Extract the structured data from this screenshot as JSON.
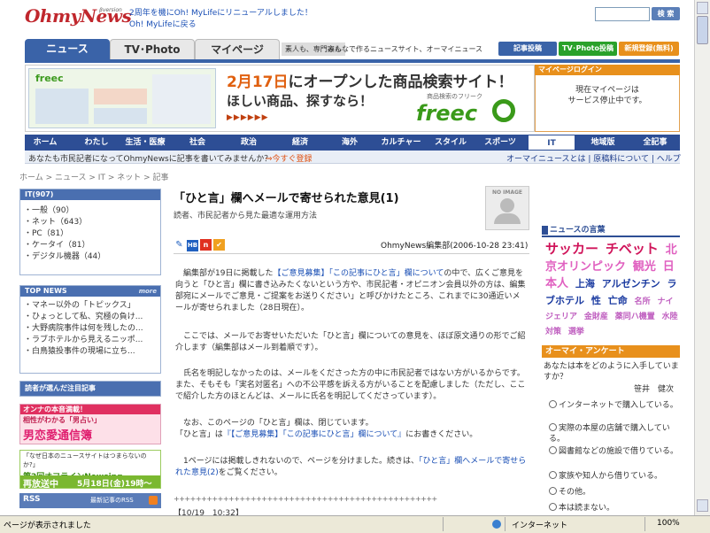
{
  "header": {
    "logo": "OhmyNews",
    "logo_sub": "βversion",
    "news_line1": "2周年を機にOh! MyLifeにリニューアルしました！",
    "news_line2": "Oh! MyLifeに戻る",
    "search_button": "検 索"
  },
  "tabs": [
    "ニュース",
    "TV･Photo",
    "マイページ"
  ],
  "tagline_a": "素人も、専門家も",
  "tagline_b": "みんなで作るニュースサイト、オーマイニュース",
  "top_buttons": {
    "post": "記事投稿",
    "tvphoto": "TV･Photo投稿",
    "register": "新規登録(無料)"
  },
  "banner": {
    "thumb_logo": "freec",
    "h1_date": "2月17日",
    "h1_rest": "にオープンした商品検索サイト！",
    "h2": "ほしい商品、探すなら！",
    "h3": "▶▶▶▶▶▶",
    "sub": "商品検索のフリーク",
    "logo": "freec"
  },
  "mypage": {
    "head": "マイページログイン",
    "line1": "現在マイページは",
    "line2": "サービス停止中です。"
  },
  "categories": [
    "ホーム",
    "わたし",
    "生活・医療",
    "社会",
    "政治",
    "経済",
    "海外",
    "カルチャー",
    "スタイル",
    "スポーツ",
    "IT",
    "地域版",
    "全記事"
  ],
  "sub_bar": {
    "left": "あなたも市民記者になってOhmyNewsに記事を書いてみませんか？",
    "register": "⇒今すぐ登録",
    "right": "オーマイニュースとは | 原稿料について | ヘルプ"
  },
  "breadcrumb": "ホーム > ニュース > IT > ネット > 記事",
  "left": {
    "it_head": "IT(907)",
    "it_items": [
      "・一般（90）",
      "・ネット（643）",
      "・PC（81）",
      "・ケータイ（81）",
      "・デジタル機器（44）"
    ],
    "top_news_head": "TOP NEWS",
    "more": "more",
    "top_news": [
      "・マネー以外の「トピックス」",
      "・ひょっとして私、究極の負け...",
      "・大野病院事件は何を残したの...",
      "・ラブホテルから見えるニッポ...",
      "・白鳥猿投事件の現場に立ち..."
    ],
    "reader_head": "読者が選んだ注目記事",
    "ad1_line1": "オンナの本音満載！",
    "ad1_line2": "相性がわかる「男占い」",
    "ad1_line3": "男恋愛通信簿",
    "ad2_line1": "「なぜ日本のニュースサイトはつまらないのか?」",
    "ad2_line2": "第2回オフラインNewsing",
    "ad2_line3": "再放送中",
    "ad2_line4": "5月18日(金)19時〜",
    "rss": "RSS",
    "rss_latest": "最新記事のRSS"
  },
  "article": {
    "title": "「ひと言」欄へメールで寄せられた意見(1)",
    "subtitle": "読者、市民記者から見た最適な運用方法",
    "noimage": "NO IMAGE",
    "icon_hb": "HB",
    "icon_n": "n",
    "byline": "OhmyNews編集部(2006-10-28 23:41)",
    "p1a": "　編集部が19日に掲載した",
    "p1_link": "【ご意見募集】「この記事にひと言」欄について",
    "p1b": "の中で、広くご意見を向うと「ひと言」欄に書き込みたくないという方や、市民記者・オピニオン会員以外の方は、編集部宛にメールでご意見・ご提案をお送りください」と呼びかけたところ、これまでに30通近いメールが寄せられました（28日現在）。",
    "p2": "　ここでは、メールでお寄せいただいた「ひと言」欄についての意見を、ほぼ原文通りの形でご紹介します（編集部はメール到着順です）。",
    "p3": "　氏名を明記しなかったのは、メールをくださった方の中に市民記者ではない方がいるからです。また、そもそも「実名対匿名」への不公平感を訴える方がいることを配慮しました（ただし、ここで紹介した方のほとんどは、メールに氏名を明記してくださっています）。",
    "p4a": "　なお、このページの「ひと言」欄は、閉じています。",
    "p4b": "「ひと言」は",
    "p4_link": "『【ご意見募集】「この記事にひと言」欄について』",
    "p4c": "にお書きください。",
    "p5a": "　1ページには掲載しきれないので、ページを分けました。続きは、",
    "p5_link": "「ひと言」欄へメールで寄せられた意見(2)",
    "p5b": "をご覧ください。",
    "plus": "++++++++++++++++++++++++++++++++++++++++++++++++",
    "date": "【10/19　10:32】"
  },
  "right": {
    "tag_head": "ニュースの言葉",
    "tags": [
      {
        "text": "サッカー",
        "size": 15,
        "color": "#d0145a"
      },
      {
        "text": "チベット",
        "size": 15,
        "color": "#d0145a"
      },
      {
        "text": "北京オリンピック",
        "size": 13,
        "color": "#e060c0"
      },
      {
        "text": "観光",
        "size": 13,
        "color": "#e060c0"
      },
      {
        "text": "日本人",
        "size": 13,
        "color": "#e060c0"
      },
      {
        "text": "上海",
        "size": 11,
        "color": "#1a3aa0"
      },
      {
        "text": "アルゼンチン",
        "size": 11,
        "color": "#1a3aa0"
      },
      {
        "text": "ラブホテル",
        "size": 11,
        "color": "#1a3aa0"
      },
      {
        "text": "性",
        "size": 11,
        "color": "#1a3aa0"
      },
      {
        "text": "亡命",
        "size": 11,
        "color": "#1a3aa0"
      },
      {
        "text": "名所",
        "size": 9,
        "color": "#c060c0"
      },
      {
        "text": "ナイジェリア",
        "size": 9,
        "color": "#c060c0"
      },
      {
        "text": "金財産",
        "size": 9,
        "color": "#c060c0"
      },
      {
        "text": "薬同ハ機置",
        "size": 9,
        "color": "#c060c0"
      },
      {
        "text": "水陸対策",
        "size": 9,
        "color": "#c060c0"
      },
      {
        "text": "選挙",
        "size": 9,
        "color": "#c060c0"
      }
    ],
    "enquete_head": "オーマイ・アンケート",
    "question": "あなたは本をどのように入手していますか？",
    "author": "笹井　健次",
    "options": [
      "インターネットで購入している。",
      "実際の本屋の店舗で購入している。",
      "図書館などの施設で借りている。",
      "家族や知人から借りている。",
      "その他。",
      "本は読まない。"
    ]
  },
  "status": {
    "text": "ページが表示されました",
    "zone": "インターネット",
    "zoom": "100%"
  },
  "colors": {
    "brand_red": "#c0272d",
    "nav_blue": "#2d4e95",
    "accent_orange": "#e8901c"
  }
}
